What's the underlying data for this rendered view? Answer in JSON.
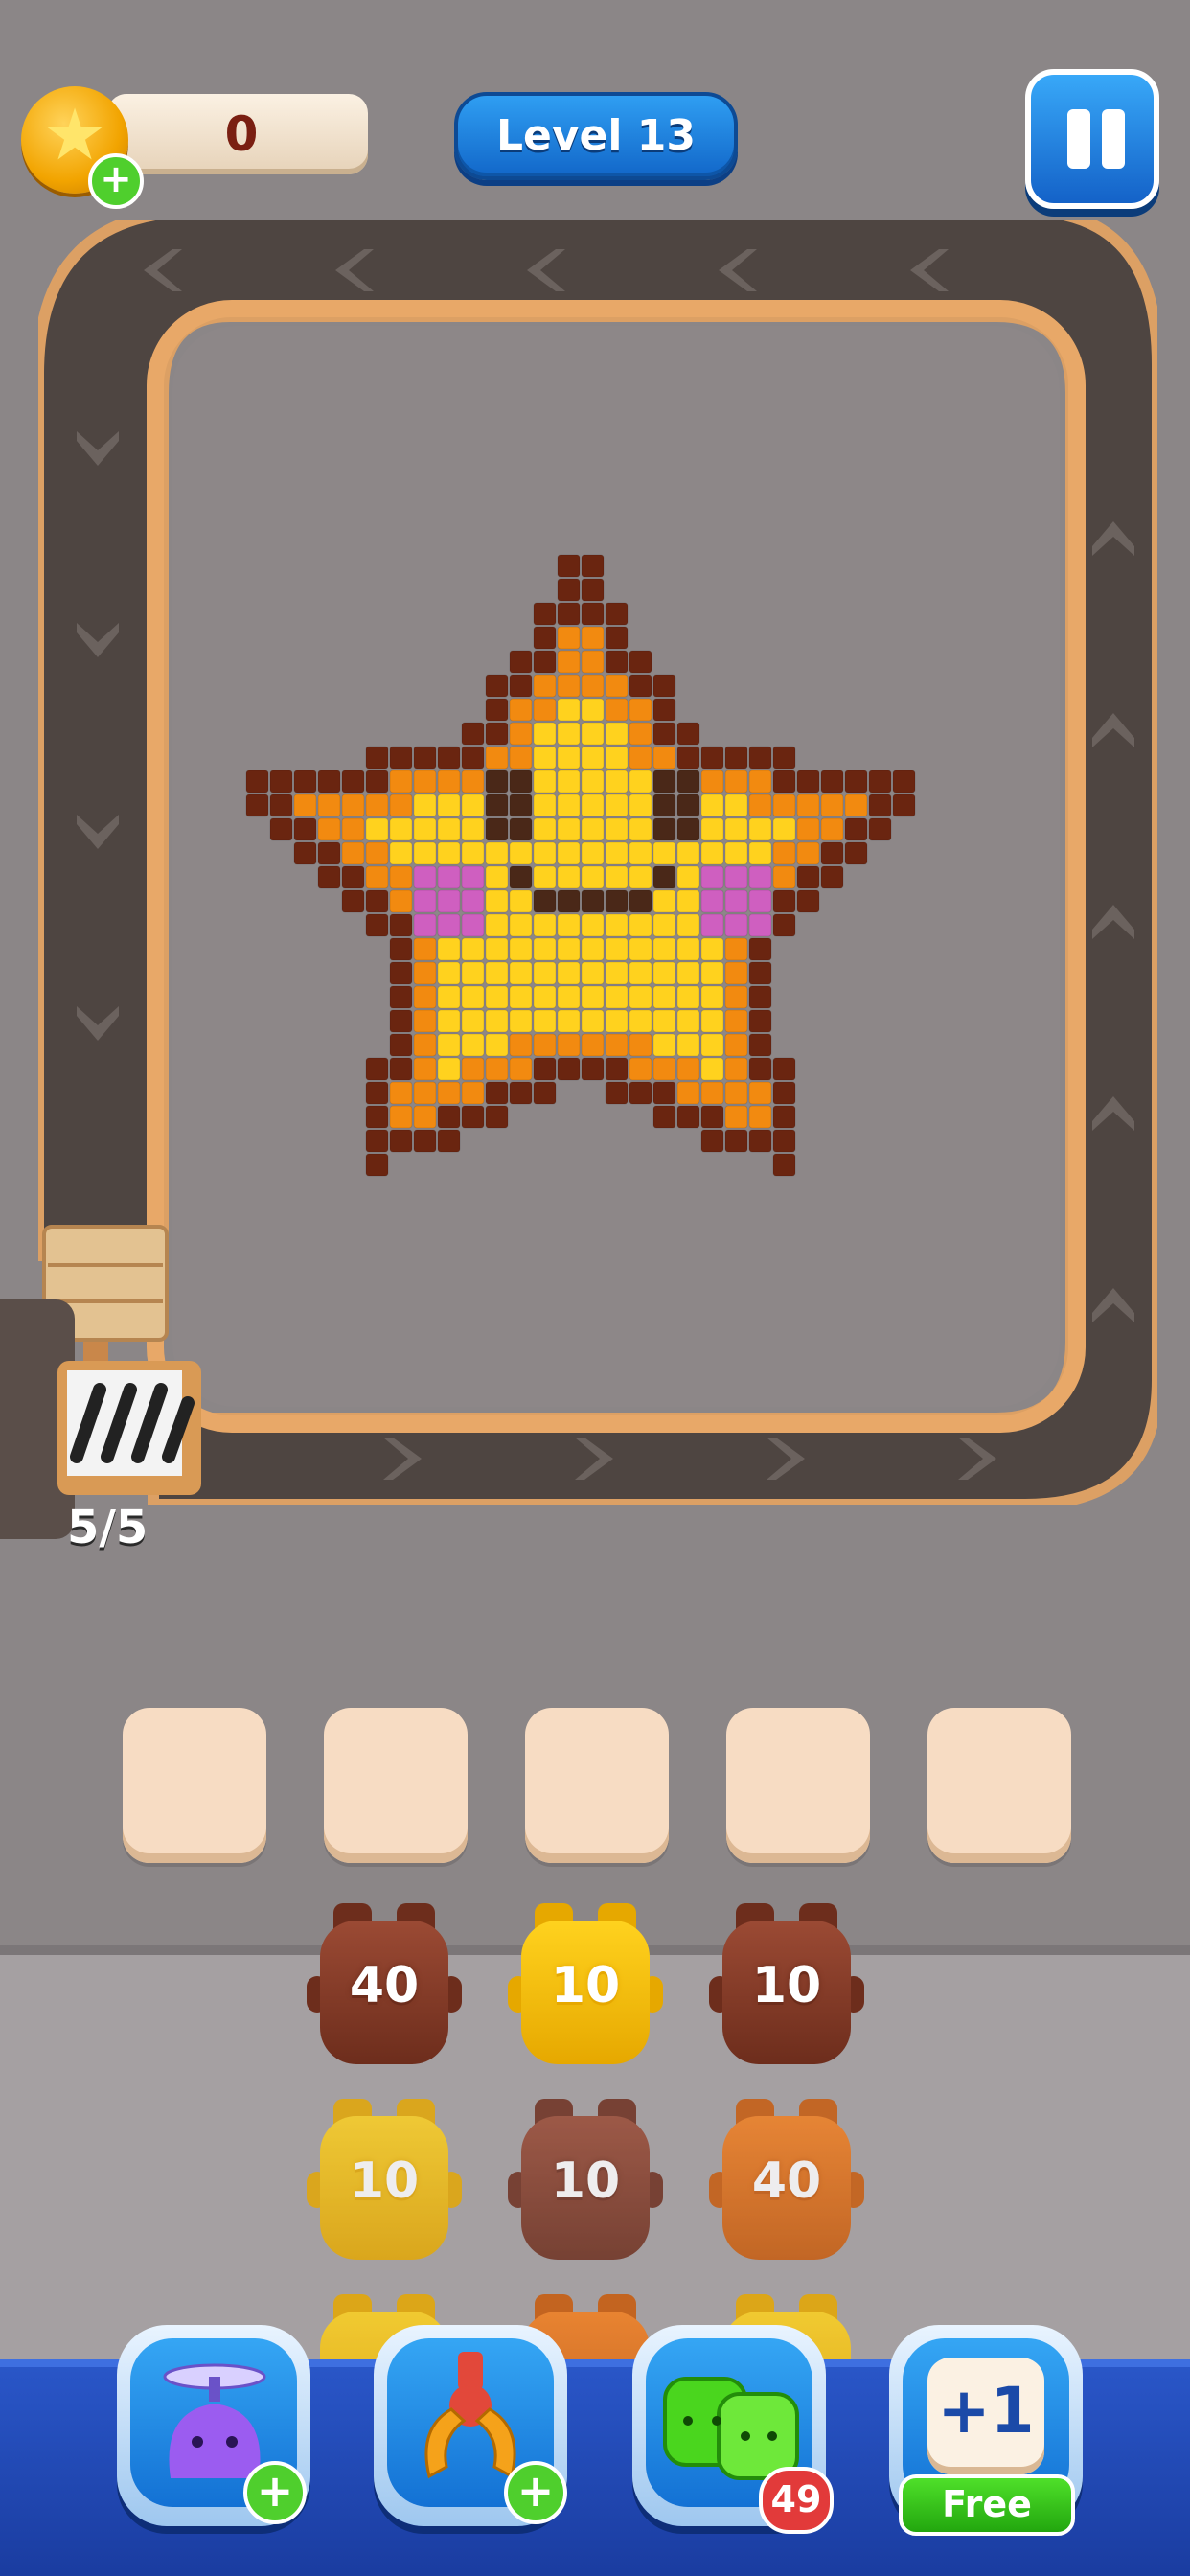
{
  "hud": {
    "coins": "0",
    "level": "Level 13",
    "pause_icon": "pause-icon",
    "coin_icon": "star-coin-icon"
  },
  "conveyor": {
    "counter": "5/5",
    "arrow_icon": "chevron-icon"
  },
  "puzzle": {
    "image": "pixel-star-face",
    "colors": {
      "outline": "#6a2510",
      "orange": "#f28a10",
      "yellow": "#ffd21e",
      "cheek": "#cf5fc0",
      "face": "#4a2818"
    }
  },
  "slots": {
    "count": 5
  },
  "blocks": {
    "rows": [
      [
        {
          "value": "40",
          "color": "brown"
        },
        {
          "value": "10",
          "color": "yellow"
        },
        {
          "value": "10",
          "color": "brown"
        }
      ],
      [
        {
          "value": "10",
          "color": "yellow"
        },
        {
          "value": "10",
          "color": "brown"
        },
        {
          "value": "40",
          "color": "orange"
        }
      ],
      [
        {
          "value": "",
          "color": "yellow"
        },
        {
          "value": "",
          "color": "orange"
        },
        {
          "value": "",
          "color": "yellow"
        }
      ]
    ]
  },
  "boosters": {
    "items": [
      {
        "name": "fan-jelly",
        "icon": "fan-jelly-icon",
        "badge": "+"
      },
      {
        "name": "claw",
        "icon": "claw-icon",
        "badge": "+"
      },
      {
        "name": "jelly-pair",
        "icon": "green-jelly-icon",
        "badge": "49"
      },
      {
        "name": "extra-slot",
        "icon": "plus-one-icon",
        "label": "+1",
        "badge": "Free"
      }
    ]
  }
}
